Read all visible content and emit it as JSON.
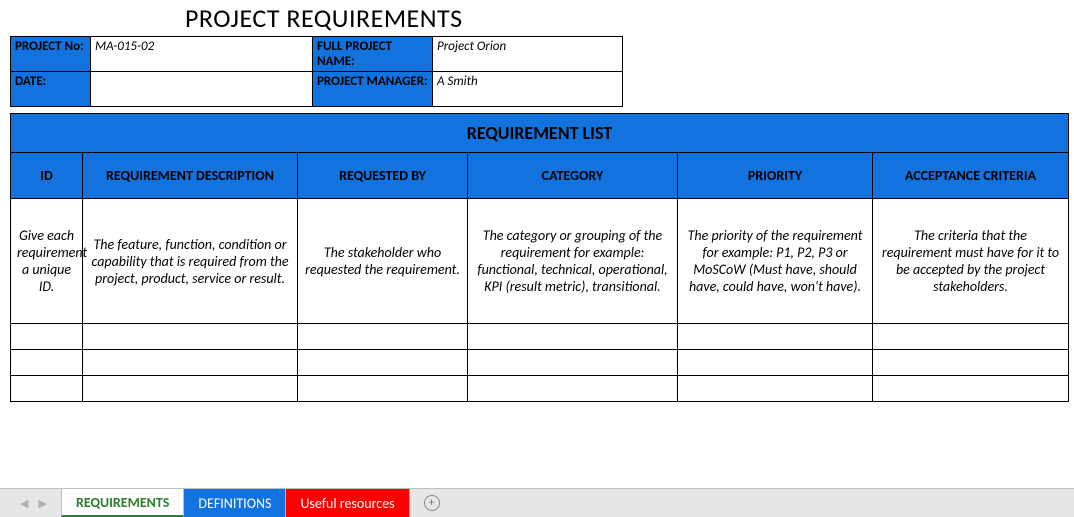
{
  "title": "PROJECT REQUIREMENTS",
  "info": {
    "project_no_label": "PROJECT No:",
    "project_no_value": "MA-015-02",
    "full_name_label": "FULL PROJECT NAME:",
    "full_name_value": "Project Orion",
    "date_label": "DATE:",
    "date_value": "",
    "pm_label": "PROJECT MANAGER:",
    "pm_value": "A Smith"
  },
  "req_list_header": "REQUIREMENT LIST",
  "columns": {
    "id": "ID",
    "desc": "REQUIREMENT DESCRIPTION",
    "requested_by": "REQUESTED BY",
    "category": "CATEGORY",
    "priority": "PRIORITY",
    "acceptance": "ACCEPTANCE CRITERIA"
  },
  "hints": {
    "id": "Give each requirement a unique ID.",
    "desc": "The feature, function, condition or capability that is required from the project, product, service or result.",
    "requested_by": "The stakeholder who requested the requirement.",
    "category": "The category or grouping of the requirement for example: functional, technical, operational, KPI (result metric), transitional.",
    "priority": "The priority of the requirement for example: P1, P2, P3 or MoSCoW (Must have, should have, could have, won't have).",
    "acceptance": "The criteria that the requirement must have for it to be accepted by the project stakeholders."
  },
  "tabs": {
    "requirements": "REQUIREMENTS",
    "definitions": "DEFINITIONS",
    "resources": "Useful resources"
  }
}
